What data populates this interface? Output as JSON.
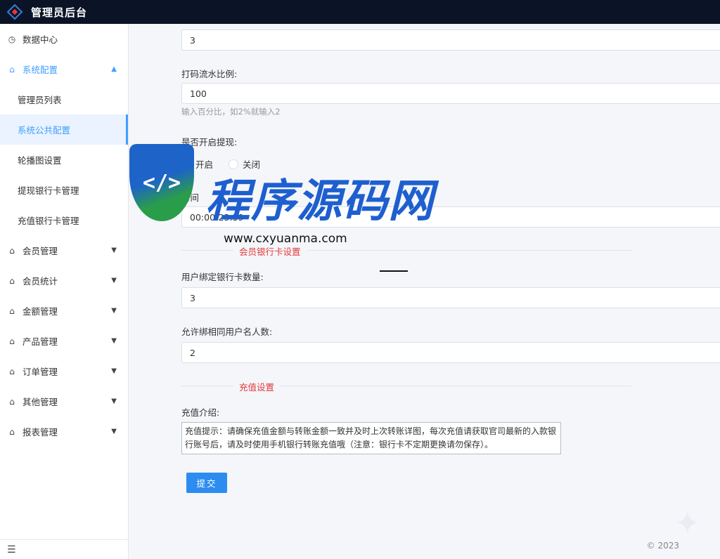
{
  "app": {
    "title": "管理员后台"
  },
  "sidebar": {
    "items": [
      {
        "label": "数据中心",
        "icon": "clock-icon"
      },
      {
        "label": "系统配置",
        "icon": "home-icon",
        "expanded": true,
        "children": [
          {
            "label": "管理员列表"
          },
          {
            "label": "系统公共配置",
            "active": true
          },
          {
            "label": "轮播图设置"
          },
          {
            "label": "提现银行卡管理"
          },
          {
            "label": "充值银行卡管理"
          }
        ]
      },
      {
        "label": "会员管理",
        "icon": "home-icon"
      },
      {
        "label": "会员统计",
        "icon": "home-icon"
      },
      {
        "label": "金额管理",
        "icon": "home-icon"
      },
      {
        "label": "产品管理",
        "icon": "home-icon"
      },
      {
        "label": "订单管理",
        "icon": "home-icon"
      },
      {
        "label": "其他管理",
        "icon": "home-icon"
      },
      {
        "label": "报表管理",
        "icon": "home-icon"
      }
    ]
  },
  "form": {
    "top_value": "3",
    "bet_ratio": {
      "label": "打码流水比例:",
      "value": "100",
      "hint": "输入百分比，如2%就输入2"
    },
    "withdraw_enabled": {
      "label": "是否开启提现:",
      "options": [
        "开启",
        "关闭"
      ],
      "selected": "开启"
    },
    "withdraw_time": {
      "label": "时间",
      "value": "00:00-23:59"
    },
    "section_bank": "会员银行卡设置",
    "bind_count": {
      "label": "用户绑定银行卡数量:",
      "value": "3"
    },
    "same_name": {
      "label": "允许绑相同用户名人数:",
      "value": "2"
    },
    "section_recharge": "充值设置",
    "recharge_intro": {
      "label": "充值介绍:",
      "value": "充值提示：请确保充值金额与转账金额一致并及时上次转账详图，每次充值请获取官司最新的入款银行账号后，请及时使用手机银行转账充值哦（注意：银行卡不定期更换请勿保存）。"
    },
    "submit_label": "提交"
  },
  "footer": {
    "copyright": "© 2023"
  },
  "watermark": {
    "brand": "程序源码网",
    "url": "www.cxyuanma.com"
  },
  "colors": {
    "topbar": "#0b1426",
    "accent": "#409eff",
    "section_title": "#e4393c",
    "button": "#2d8cf0"
  }
}
